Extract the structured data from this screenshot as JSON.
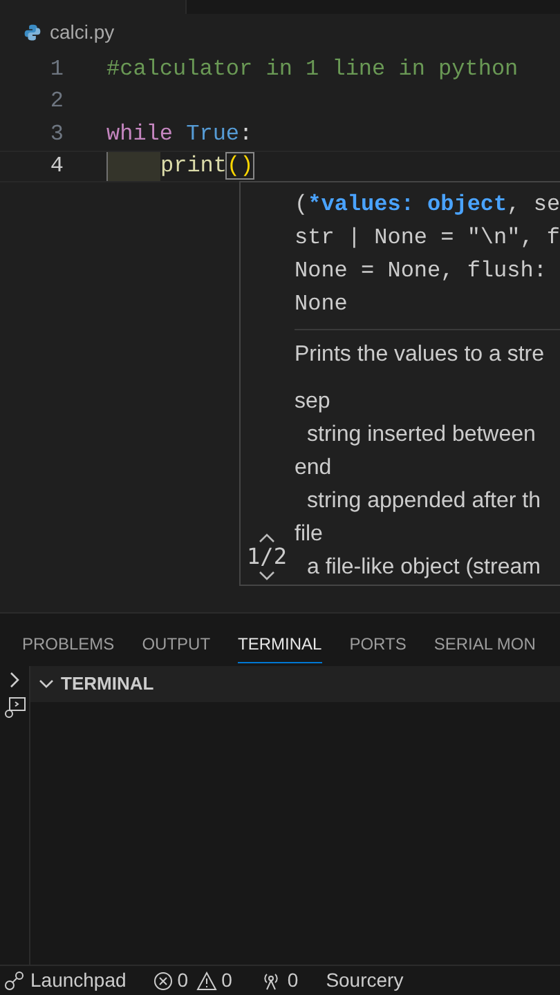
{
  "breadcrumb": {
    "file": "calci.py"
  },
  "code_lines": [
    {
      "number": "1",
      "current": false,
      "indent": false,
      "tokens": [
        {
          "text": "#calculator in 1 line in python",
          "kind": "comment"
        }
      ]
    },
    {
      "number": "2",
      "current": false,
      "indent": false
    },
    {
      "number": "3",
      "current": false,
      "indent": false,
      "tokens": [
        {
          "text": "while",
          "kind": "keyword",
          "spaced": false
        },
        {
          "text": "True",
          "kind": "constant",
          "spaced": true
        },
        {
          "text": ":",
          "kind": "plain",
          "spaced": false
        }
      ]
    },
    {
      "number": "4",
      "current": true,
      "indent": true,
      "tokens": [
        {
          "text": "print",
          "kind": "function"
        },
        {
          "text": "()",
          "kind": "bracket"
        }
      ]
    }
  ],
  "signature_help": {
    "signature_lines": [
      [
        {
          "text": "(",
          "kind": "plain"
        },
        {
          "text": "*values: object",
          "kind": "active"
        },
        {
          "text": ", se",
          "kind": "plain"
        }
      ],
      [
        {
          "text": "str | None = \"\\n\", f",
          "kind": "plain"
        }
      ],
      [
        {
          "text": "None = None, flush: ",
          "kind": "plain"
        }
      ],
      [
        {
          "text": "None",
          "kind": "plain"
        }
      ]
    ],
    "doc_lines": [
      {
        "text": "Prints the values to a stre",
        "kind": "summary"
      },
      {
        "text": "sep",
        "kind": "param"
      },
      {
        "text": "string inserted between",
        "kind": "desc"
      },
      {
        "text": "end",
        "kind": "param"
      },
      {
        "text": "string appended after th",
        "kind": "desc"
      },
      {
        "text": "file",
        "kind": "param"
      },
      {
        "text": "a file-like object (stream",
        "kind": "desc"
      }
    ],
    "overload": "1/2"
  },
  "panel_tabs": [
    {
      "label": "PROBLEMS",
      "selected": false
    },
    {
      "label": "OUTPUT",
      "selected": false
    },
    {
      "label": "TERMINAL",
      "selected": true
    },
    {
      "label": "PORTS",
      "selected": false
    },
    {
      "label": "SERIAL MON",
      "selected": false
    }
  ],
  "terminal": {
    "title": "TERMINAL",
    "expanded": true
  },
  "status_bar": {
    "launchpad": "Launchpad",
    "errors": "0",
    "warnings": "0",
    "ports": "0",
    "extension": "Sourcery"
  }
}
